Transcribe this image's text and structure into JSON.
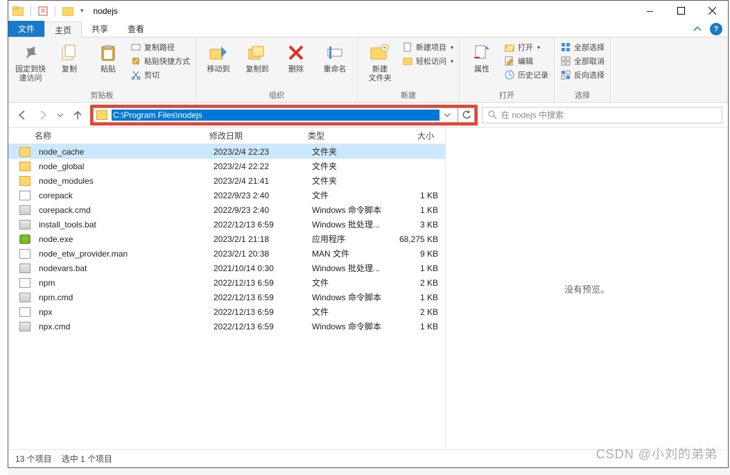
{
  "title": "nodejs",
  "menu": {
    "file": "文件",
    "home": "主页",
    "share": "共享",
    "view": "查看"
  },
  "ribbon": {
    "clipboard": {
      "label": "剪贴板",
      "pin": "固定到快\n速访问",
      "copy": "复制",
      "paste": "粘贴",
      "copypath": "复制路径",
      "pasteshortcut": "粘贴快捷方式",
      "cut": "剪切"
    },
    "organize": {
      "label": "组织",
      "moveto": "移动到",
      "copyto": "复制到",
      "delete": "删除",
      "rename": "重命名"
    },
    "new": {
      "label": "新建",
      "newfolder": "新建\n文件夹",
      "newitem": "新建项目",
      "easyaccess": "轻松访问"
    },
    "open": {
      "label": "打开",
      "properties": "属性",
      "open": "打开",
      "edit": "编辑",
      "history": "历史记录"
    },
    "select": {
      "label": "选择",
      "selectall": "全部选择",
      "selectnone": "全部取消",
      "invert": "反向选择"
    }
  },
  "address": {
    "path": "C:\\Program Files\\nodejs"
  },
  "search": {
    "placeholder": "在 nodejs 中搜索"
  },
  "columns": {
    "name": "名称",
    "date": "修改日期",
    "type": "类型",
    "size": "大小"
  },
  "files": [
    {
      "name": "node_cache",
      "date": "2023/2/4 22:23",
      "type": "文件夹",
      "size": "",
      "icon": "folder",
      "sel": true
    },
    {
      "name": "node_global",
      "date": "2023/2/4 22:22",
      "type": "文件夹",
      "size": "",
      "icon": "folder"
    },
    {
      "name": "node_modules",
      "date": "2023/2/4 21:41",
      "type": "文件夹",
      "size": "",
      "icon": "folder"
    },
    {
      "name": "corepack",
      "date": "2022/9/23 2:40",
      "type": "文件",
      "size": "1 KB",
      "icon": "file"
    },
    {
      "name": "corepack.cmd",
      "date": "2022/9/23 2:40",
      "type": "Windows 命令脚本",
      "size": "1 KB",
      "icon": "bat"
    },
    {
      "name": "install_tools.bat",
      "date": "2022/12/13 6:59",
      "type": "Windows 批处理...",
      "size": "3 KB",
      "icon": "bat"
    },
    {
      "name": "node.exe",
      "date": "2023/2/1 21:18",
      "type": "应用程序",
      "size": "68,275 KB",
      "icon": "exe"
    },
    {
      "name": "node_etw_provider.man",
      "date": "2023/2/1 20:38",
      "type": "MAN 文件",
      "size": "9 KB",
      "icon": "file"
    },
    {
      "name": "nodevars.bat",
      "date": "2021/10/14 0:30",
      "type": "Windows 批处理...",
      "size": "1 KB",
      "icon": "bat"
    },
    {
      "name": "npm",
      "date": "2022/12/13 6:59",
      "type": "文件",
      "size": "2 KB",
      "icon": "file"
    },
    {
      "name": "npm.cmd",
      "date": "2022/12/13 6:59",
      "type": "Windows 命令脚本",
      "size": "1 KB",
      "icon": "bat"
    },
    {
      "name": "npx",
      "date": "2022/12/13 6:59",
      "type": "文件",
      "size": "2 KB",
      "icon": "file"
    },
    {
      "name": "npx.cmd",
      "date": "2022/12/13 6:59",
      "type": "Windows 命令脚本",
      "size": "1 KB",
      "icon": "bat"
    }
  ],
  "preview": "没有预览。",
  "status": {
    "count": "13 个项目",
    "selected": "选中 1 个项目"
  },
  "watermark": "CSDN @小刘的弟弟"
}
